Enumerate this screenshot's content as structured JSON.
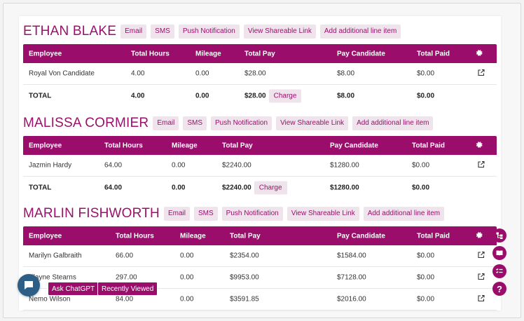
{
  "columns": [
    "Employee",
    "Total Hours",
    "Mileage",
    "Total Pay",
    "Pay Candidate",
    "Total Paid"
  ],
  "actions": {
    "email": "Email",
    "sms": "SMS",
    "push": "Push Notification",
    "share": "View Shareable Link",
    "add": "Add additional line item",
    "charge": "Charge",
    "total_label": "TOTAL"
  },
  "sections": [
    {
      "name": "ETHAN BLAKE",
      "rows": [
        {
          "employee": "Royal Von Candidate",
          "hours": "4.00",
          "mileage": "0.00",
          "pay": "$28.00",
          "pay_candidate": "$8.00",
          "paid": "$0.00"
        }
      ],
      "total": {
        "hours": "4.00",
        "mileage": "0.00",
        "pay": "$28.00",
        "pay_candidate": "$8.00",
        "paid": "$0.00"
      }
    },
    {
      "name": "MALISSA CORMIER",
      "rows": [
        {
          "employee": "Jazmin Hardy",
          "hours": "64.00",
          "mileage": "0.00",
          "pay": "$2240.00",
          "pay_candidate": "$1280.00",
          "paid": "$0.00"
        }
      ],
      "total": {
        "hours": "64.00",
        "mileage": "0.00",
        "pay": "$2240.00",
        "pay_candidate": "$1280.00",
        "paid": "$0.00"
      }
    },
    {
      "name": "MARLIN FISHWORTH",
      "rows": [
        {
          "employee": "Marilyn Galbraith",
          "hours": "66.00",
          "mileage": "0.00",
          "pay": "$2354.00",
          "pay_candidate": "$1584.00",
          "paid": "$0.00"
        },
        {
          "employee": "Elayne Stearns",
          "hours": "297.00",
          "mileage": "0.00",
          "pay": "$9953.00",
          "pay_candidate": "$7128.00",
          "paid": "$0.00"
        },
        {
          "employee": "Nemo Wilson",
          "hours": "84.00",
          "mileage": "0.00",
          "pay": "$3591.85",
          "pay_candidate": "$2016.00",
          "paid": "$0.00"
        }
      ]
    }
  ],
  "floating": {
    "ask": "Ask ChatGPT",
    "recent": "Recently Viewed",
    "help": "?"
  },
  "colors": {
    "accent": "#9a0d6b",
    "button_bg": "#efe3ec",
    "chat": "#2d5f86"
  }
}
